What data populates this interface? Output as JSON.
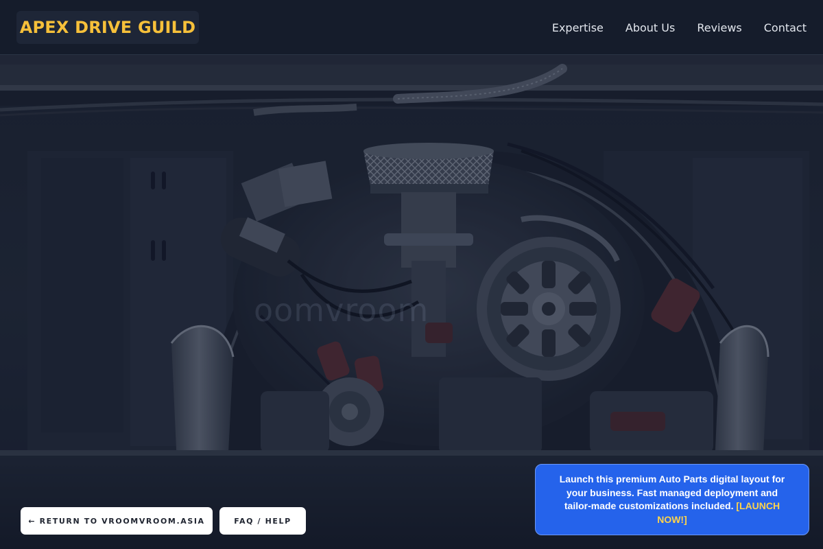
{
  "header": {
    "logo": "APEX DRIVE GUILD",
    "nav": [
      {
        "label": "Expertise"
      },
      {
        "label": "About Us"
      },
      {
        "label": "Reviews"
      },
      {
        "label": "Contact"
      }
    ]
  },
  "hero": {
    "image_subject": "engine-bay-photo",
    "watermark": "oomvroom"
  },
  "footer_buttons": {
    "return_label": "← RETURN TO VROOMVROOM.ASIA",
    "faq_label": "FAQ / HELP"
  },
  "promo": {
    "text": "Launch this premium Auto Parts digital layout for your business. Fast managed deployment and tailor-made customizations included.",
    "link_label": "[LAUNCH NOW!]"
  },
  "colors": {
    "header_bg": "#151c2b",
    "logo_color": "#f6c03a",
    "nav_text": "#e3e7ee",
    "promo_bg": "#2563eb",
    "promo_link": "#fcd34d",
    "button_bg": "#ffffff"
  }
}
